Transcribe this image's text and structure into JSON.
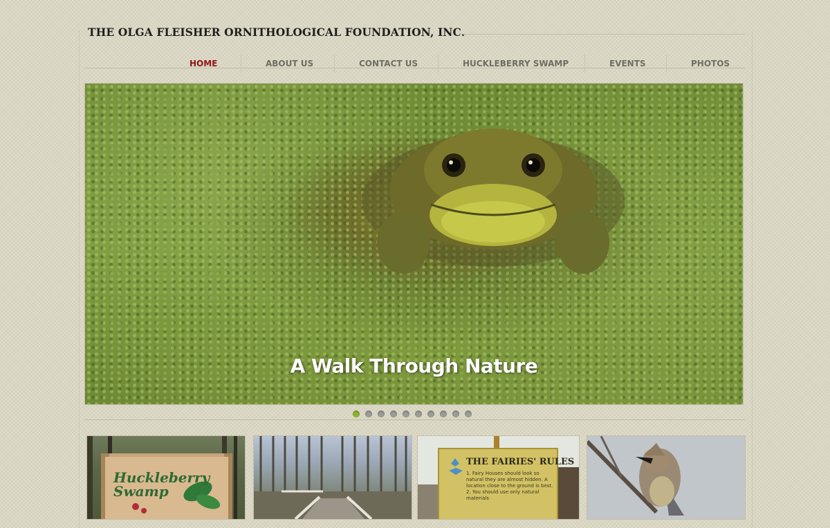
{
  "site": {
    "title": "THE OLGA FLEISHER ORNITHOLOGICAL FOUNDATION, INC."
  },
  "nav": {
    "items": [
      {
        "label": "HOME",
        "active": true
      },
      {
        "label": "ABOUT US",
        "active": false
      },
      {
        "label": "CONTACT US",
        "active": false
      },
      {
        "label": "HUCKLEBERRY SWAMP",
        "active": false
      },
      {
        "label": "EVENTS",
        "active": false
      },
      {
        "label": "PHOTOS",
        "active": false
      }
    ]
  },
  "hero": {
    "caption": "A Walk Through Nature",
    "slide_count": 10,
    "active_slide": 1
  },
  "thumbnails": {
    "sign_text": "Huckleberry Swamp",
    "rules_title": "THE FAIRIES' RULES",
    "rules_text": "1. Fairy Houses should look so natural they are almost hidden. A location close to the ground is best. 2. You should use only natural materials"
  },
  "colors": {
    "active_nav": "#8f1414",
    "nav_text": "#6e6e63",
    "active_dot": "#8db431",
    "inactive_dot": "#9d9d98",
    "background": "#dcd8c5"
  }
}
